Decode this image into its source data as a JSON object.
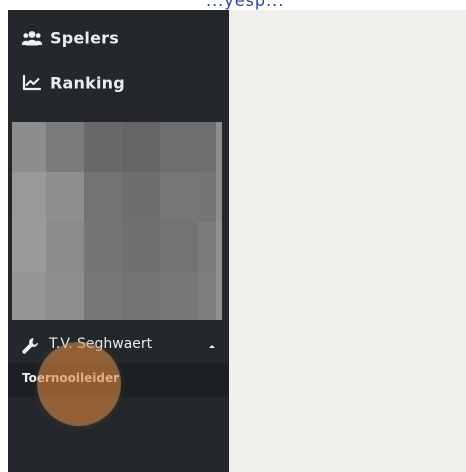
{
  "top_partial_text": "...yesp...",
  "sidebar": {
    "items": [
      {
        "label": "Spelers",
        "icon": "users-icon"
      },
      {
        "label": "Ranking",
        "icon": "chart-line-icon"
      }
    ],
    "club": {
      "label": "T.V. Seghwaert",
      "icon": "wrench-icon",
      "caret": "caret-up-icon"
    },
    "submenu": {
      "label": "Toernooileider"
    }
  },
  "colors": {
    "sidebar_bg": "#24272b",
    "submenu_bg": "#1c1f23",
    "content_bg": "#f1efeb",
    "click_marker": "#d6853a"
  }
}
